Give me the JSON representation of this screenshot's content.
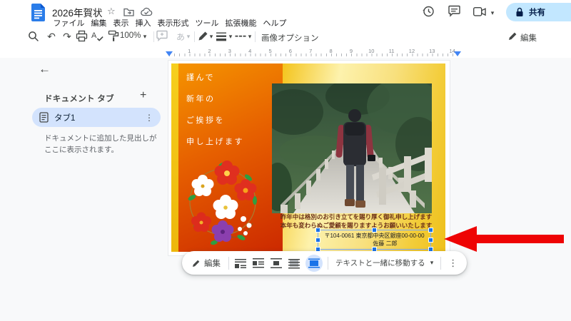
{
  "icons": {
    "star": "☆",
    "plus": "+",
    "kebab": "⋮",
    "back_arrow": "←",
    "dropdown": "▾",
    "undo": "↶",
    "redo": "↷",
    "furigana": "あ"
  },
  "header": {
    "title": "2026年賀状",
    "menu_items": [
      "ファイル",
      "編集",
      "表示",
      "挿入",
      "表示形式",
      "ツール",
      "拡張機能",
      "ヘルプ"
    ],
    "share_label": "共有",
    "editing_mode_label": "編集"
  },
  "toolbar": {
    "zoom_value": "100%",
    "image_options_label": "画像オプション"
  },
  "ruler": {
    "numbers": [
      "1",
      "2",
      "3",
      "4",
      "5",
      "6",
      "7",
      "8",
      "9",
      "10",
      "11",
      "12",
      "13",
      "14"
    ]
  },
  "sidebar": {
    "section_title": "ドキュメント タブ",
    "tab_label": "タブ1",
    "empty_hint": "ドキュメントに追加した見出しがここに表示されます。"
  },
  "card": {
    "greeting_lines": [
      "謹んで",
      "新年の",
      "ご挨拶を",
      "申し上げます"
    ],
    "message_lines": [
      "昨年中は格別のお引き立てを賜り厚く御礼申し上げます",
      "本年も変わらぬご愛顧を賜りますようお願いいたします"
    ],
    "textbox": {
      "address": "〒104-0061 東京都中央区銀座00-00-00",
      "name": "佐藤 二郎"
    }
  },
  "image_toolbar": {
    "edit_label": "編集",
    "move_with_text_label": "テキストと一緒に移動する"
  },
  "colors": {
    "accent_blue": "#1a73e8",
    "share_pill_bg": "#c2e7ff",
    "tab_pill_bg": "#d3e3fd",
    "selection_handle": "#1a73e8",
    "arrow_red": "#ee0404",
    "card_yellow": "#f2c51d",
    "card_orange": "#e85c00",
    "card_deep_red": "#cd2d00"
  }
}
